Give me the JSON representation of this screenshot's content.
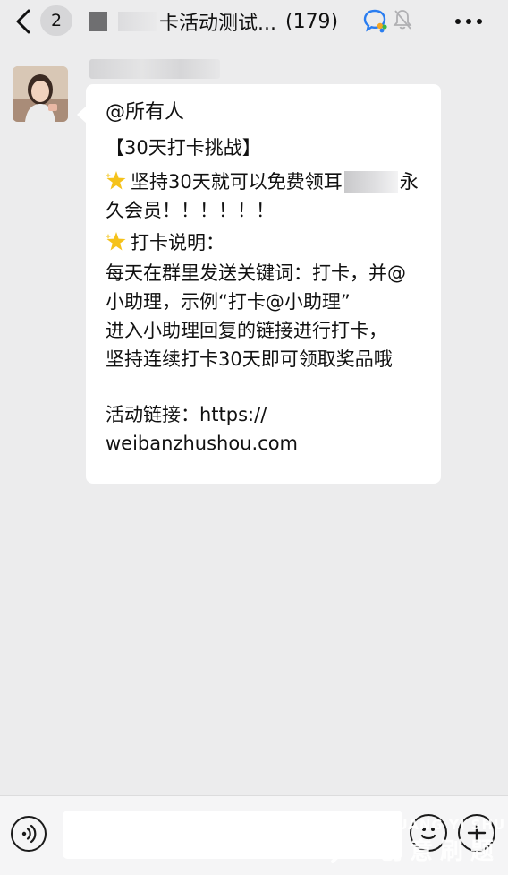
{
  "header": {
    "back_icon": "chevron-left-icon",
    "unread_count": "2",
    "group_title": "卡活动测试...",
    "member_count": "(179)",
    "wecom_icon": "wecom-badge-icon",
    "mute_icon": "bell-muted-icon",
    "more_icon": "ellipsis-icon"
  },
  "message": {
    "mention": "@所有人",
    "headline": "【30天打卡挑战】",
    "reward_line_1_a": "坚持30天就可以免费领耳",
    "reward_line_1_b": "永",
    "reward_line_2": "久会员！！！！！！",
    "rules_title": "打卡说明：",
    "rules_line_1": "每天在群里发送关键词：打卡，并@",
    "rules_line_2": "小助理，示例“打卡@小助理”",
    "rules_line_3": "进入小助理回复的链接进行打卡，",
    "rules_line_4": "坚持连续打卡30天即可领取奖品哦",
    "link_label": "活动链接：https://",
    "link_url": "weibanzhushou.com",
    "star_icon": "star-sparkle-icon"
  },
  "input_bar": {
    "voice_icon": "voice-icon",
    "input_value": "",
    "emoji_icon": "emoji-icon",
    "plus_icon": "plus-icon"
  },
  "watermark": {
    "english": "CHUANG YI SHU",
    "chinese": "创意刷题"
  },
  "colors": {
    "background": "#ececed",
    "bubble": "#ffffff",
    "bottom_bar": "#f5f5f6",
    "wecom_blue": "#2a7df0",
    "wecom_green": "#3bb54a",
    "star_yellow": "#f5c21b"
  }
}
